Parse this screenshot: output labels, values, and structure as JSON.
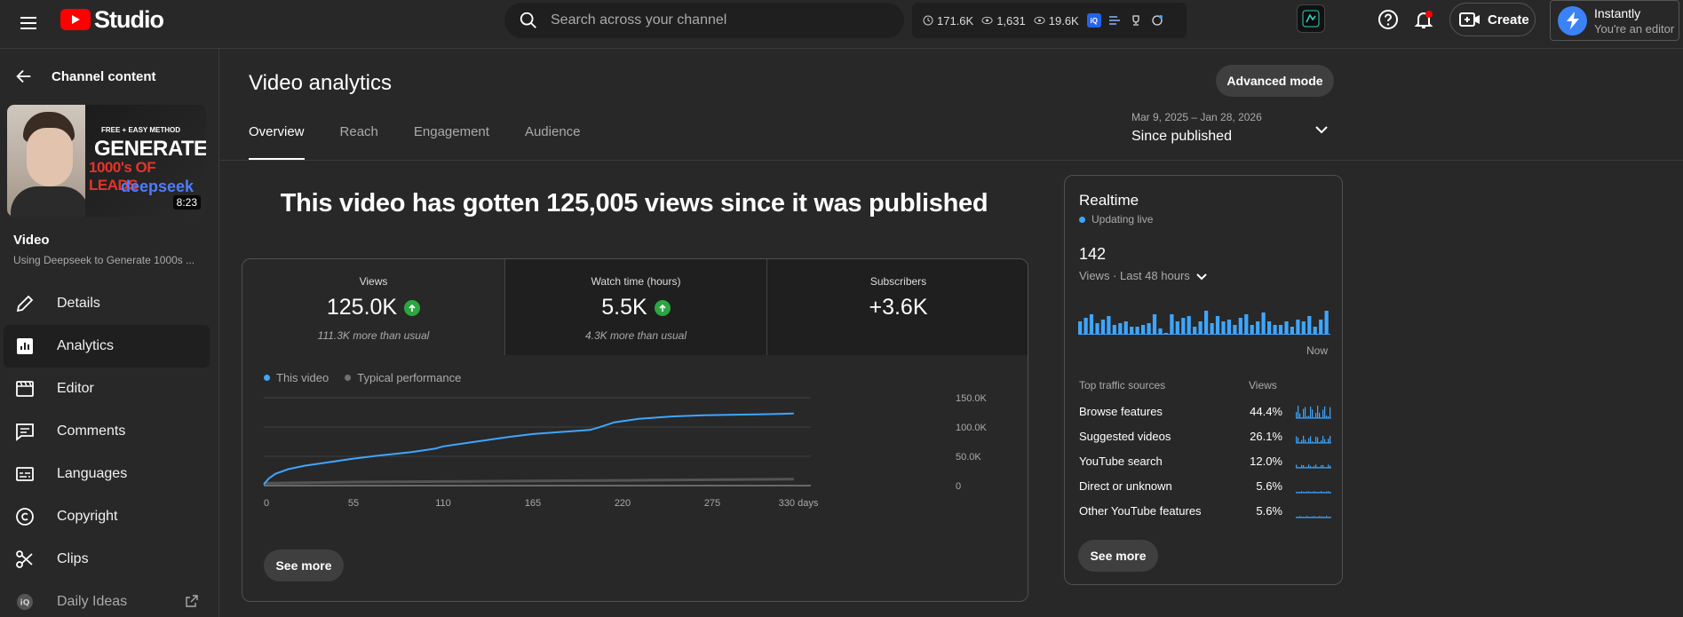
{
  "topbar": {
    "logo_text": "Studio",
    "search_placeholder": "Search across your channel",
    "ext_stats": [
      "171.6K",
      "1,631",
      "19.6K"
    ],
    "ext_badge": "iQ",
    "create_label": "Create",
    "account_name": "Instantly",
    "account_role": "You're an editor"
  },
  "sidebar": {
    "back_label": "Channel content",
    "thumb": {
      "small_text": "FREE + EASY METHOD",
      "big_text": "GENERATE",
      "leads_text": "1000's OF LEADS",
      "brand_text": "deepseek",
      "duration": "8:23"
    },
    "video_label": "Video",
    "video_title": "Using Deepseek to Generate 1000s ...",
    "items": [
      {
        "label": "Details",
        "icon": "pencil-icon"
      },
      {
        "label": "Analytics",
        "icon": "analytics-icon"
      },
      {
        "label": "Editor",
        "icon": "film-icon"
      },
      {
        "label": "Comments",
        "icon": "comment-icon"
      },
      {
        "label": "Languages",
        "icon": "subtitles-icon"
      },
      {
        "label": "Copyright",
        "icon": "copyright-icon"
      },
      {
        "label": "Clips",
        "icon": "scissors-icon"
      },
      {
        "label": "Daily Ideas",
        "icon": "iq-icon"
      }
    ]
  },
  "main": {
    "title": "Video analytics",
    "advanced_mode": "Advanced mode",
    "tabs": [
      "Overview",
      "Reach",
      "Engagement",
      "Audience"
    ],
    "date_range": "Mar 9, 2025 – Jan 28, 2026",
    "date_label": "Since published",
    "headline": "This video has gotten 125,005 views since it was published",
    "metrics": [
      {
        "label": "Views",
        "value": "125.0K",
        "sub": "111.3K more than usual"
      },
      {
        "label": "Watch time (hours)",
        "value": "5.5K",
        "sub": "4.3K more than usual"
      },
      {
        "label": "Subscribers",
        "value": "+3.6K",
        "sub": ""
      }
    ],
    "legend": [
      "This video",
      "Typical performance"
    ],
    "see_more": "See more"
  },
  "chart_data": {
    "type": "line",
    "x_ticks": [
      "0",
      "55",
      "110",
      "165",
      "220",
      "275",
      "330 days"
    ],
    "y_ticks": [
      "150.0K",
      "100.0K",
      "50.0K",
      "0"
    ],
    "ylim": [
      0,
      150000
    ],
    "xlim": [
      0,
      330
    ],
    "series": [
      {
        "name": "This video",
        "color": "#3ea6ff",
        "x": [
          0,
          3,
          7,
          15,
          25,
          40,
          55,
          70,
          90,
          105,
          110,
          130,
          150,
          165,
          180,
          200,
          205,
          215,
          230,
          250,
          270,
          290,
          310,
          325
        ],
        "y": [
          2000,
          12000,
          20000,
          28000,
          34000,
          40000,
          46000,
          51000,
          57000,
          63000,
          67000,
          75000,
          83000,
          88000,
          91000,
          95000,
          99000,
          108000,
          114000,
          118000,
          120000,
          121000,
          122000,
          123000
        ]
      },
      {
        "name": "Typical performance",
        "color": "#717171",
        "x": [
          0,
          55,
          110,
          165,
          220,
          275,
          325
        ],
        "y": [
          4000,
          6000,
          7000,
          8000,
          9000,
          10000,
          11000
        ]
      }
    ]
  },
  "realtime": {
    "title": "Realtime",
    "status": "Updating live",
    "count": "142",
    "range": "Views · Last 48 hours",
    "now": "Now",
    "bars": [
      14,
      18,
      22,
      12,
      16,
      20,
      10,
      12,
      14,
      8,
      8,
      10,
      12,
      22,
      6,
      0,
      22,
      14,
      18,
      20,
      8,
      14,
      26,
      12,
      20,
      14,
      16,
      10,
      18,
      22,
      10,
      14,
      24,
      14,
      10,
      10,
      14,
      8,
      16,
      14,
      20,
      8,
      16,
      26
    ],
    "sources_header": "Top traffic sources",
    "views_header": "Views",
    "sources": [
      {
        "name": "Browse features",
        "pct": "44.4%"
      },
      {
        "name": "Suggested videos",
        "pct": "26.1%"
      },
      {
        "name": "YouTube search",
        "pct": "12.0%"
      },
      {
        "name": "Direct or unknown",
        "pct": "5.6%"
      },
      {
        "name": "Other YouTube features",
        "pct": "5.6%"
      }
    ],
    "see_more": "See more"
  },
  "colors": {
    "accent": "#3ea6ff",
    "up": "#2ba640",
    "notif": "#ff0000"
  }
}
